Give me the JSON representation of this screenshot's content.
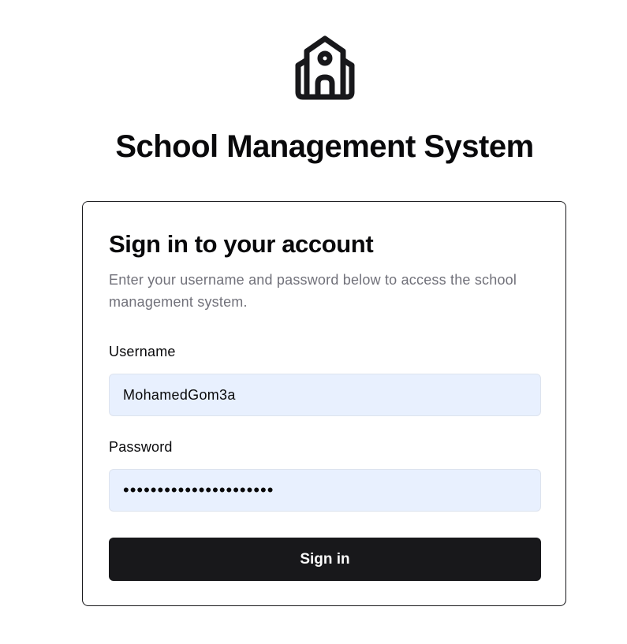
{
  "header": {
    "logo_icon": "school-building-icon",
    "title": "School Management System"
  },
  "login_card": {
    "title": "Sign in to your account",
    "description": "Enter your username and password below to access the school management system.",
    "username_label": "Username",
    "username_value": "MohamedGom3a",
    "password_label": "Password",
    "password_value": "••••••••••••••••••••••",
    "submit_label": "Sign in"
  },
  "colors": {
    "primary": "#18181b",
    "input_autofill_bg": "#e8f0fe",
    "muted_text": "#71717a"
  }
}
